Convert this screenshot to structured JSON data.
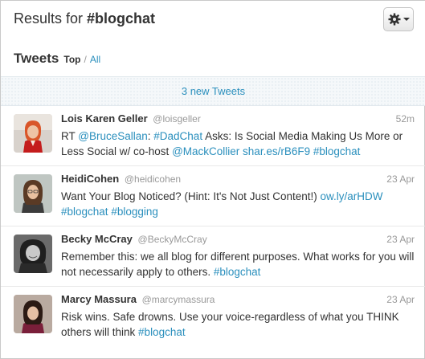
{
  "header": {
    "title_prefix": "Results for",
    "title_query": "#blogchat",
    "tweets_label": "Tweets",
    "filter_top": "Top",
    "filter_sep": "/",
    "filter_all": "All"
  },
  "new_tweets_label": "3 new Tweets",
  "colors": {
    "link": "#2a8fbd",
    "muted": "#999999",
    "text": "#333333"
  },
  "tweets": [
    {
      "name": "Lois Karen Geller",
      "handle": "@loisgeller",
      "time": "52m",
      "parts": [
        {
          "t": "RT "
        },
        {
          "t": "@BruceSallan",
          "link": true
        },
        {
          "t": ": "
        },
        {
          "t": "#DadChat",
          "link": true
        },
        {
          "t": " Asks: Is Social Media Making Us More or Less Social w/ co-host "
        },
        {
          "t": "@MackCollier",
          "link": true
        },
        {
          "t": " "
        },
        {
          "t": "shar.es/rB6F9",
          "link": true
        },
        {
          "t": " "
        },
        {
          "t": "#blogchat",
          "link": true
        }
      ]
    },
    {
      "name": "HeidiCohen",
      "handle": "@heidicohen",
      "time": "23 Apr",
      "parts": [
        {
          "t": "Want Your Blog Noticed? (Hint: It's Not Just Content!) "
        },
        {
          "t": "ow.ly/arHDW",
          "link": true
        },
        {
          "t": " "
        },
        {
          "t": "#blogchat",
          "link": true
        },
        {
          "t": " "
        },
        {
          "t": "#blogging",
          "link": true
        }
      ]
    },
    {
      "name": "Becky McCray",
      "handle": "@BeckyMcCray",
      "time": "23 Apr",
      "parts": [
        {
          "t": "Remember this: we all blog for different purposes. What works for you will not necessarily apply to others. "
        },
        {
          "t": "#blogchat",
          "link": true
        }
      ]
    },
    {
      "name": "Marcy Massura",
      "handle": "@marcymassura",
      "time": "23 Apr",
      "parts": [
        {
          "t": "Risk wins. Safe drowns. Use your voice-regardless of what you THINK others will think "
        },
        {
          "t": "#blogchat",
          "link": true
        }
      ]
    }
  ]
}
